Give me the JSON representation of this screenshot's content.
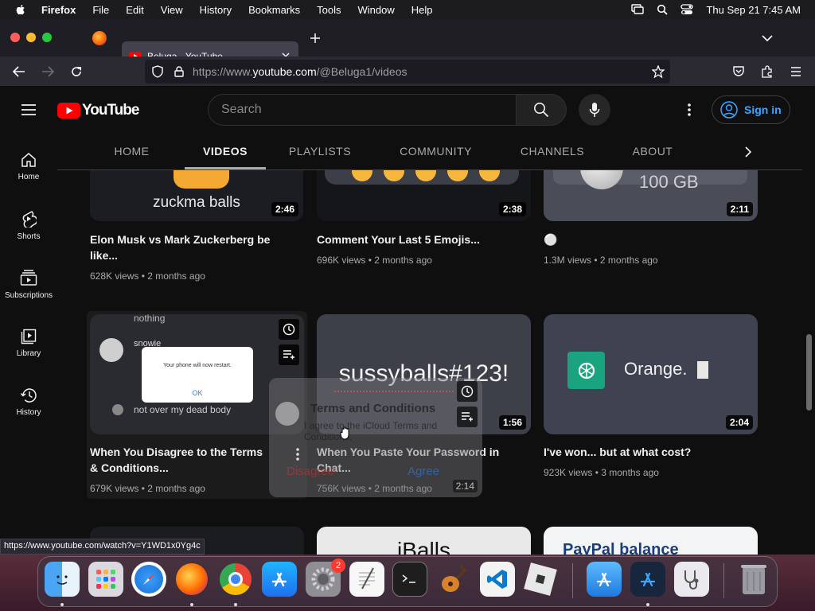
{
  "menubar": {
    "app": "Firefox",
    "items": [
      "File",
      "Edit",
      "View",
      "History",
      "Bookmarks",
      "Tools",
      "Window",
      "Help"
    ],
    "clock": "Thu Sep 21  7:45 AM"
  },
  "browser": {
    "tab_title": "Beluga - YouTube",
    "url_prefix": "https://www.",
    "url_host": "youtube.com",
    "url_path": "/@Beluga1/videos",
    "status_url": "https://www.youtube.com/watch?v=Y1WD1x0Yg4c"
  },
  "youtube": {
    "logo_text": "YouTube",
    "search_placeholder": "Search",
    "sign_in": "Sign in",
    "guide": [
      {
        "label": "Home",
        "icon": "home-icon"
      },
      {
        "label": "Shorts",
        "icon": "shorts-icon"
      },
      {
        "label": "Subscriptions",
        "icon": "subscriptions-icon"
      },
      {
        "label": "Library",
        "icon": "library-icon"
      },
      {
        "label": "History",
        "icon": "history-icon"
      }
    ],
    "channel_tabs": [
      "HOME",
      "VIDEOS",
      "PLAYLISTS",
      "COMMUNITY",
      "CHANNELS",
      "ABOUT"
    ],
    "active_tab": "VIDEOS"
  },
  "videos_row1": [
    {
      "title": "Elon Musk vs Mark Zuckerberg be like...",
      "meta": "628K views • 2 months ago",
      "duration": "2:46",
      "thumb_text": "zuckma balls"
    },
    {
      "title": "Comment Your Last 5 Emojis...",
      "meta": "696K views • 2 months ago",
      "duration": "2:38",
      "thumb_text": ""
    },
    {
      "title": "⚪",
      "meta": "1.3M views • 2 months ago",
      "duration": "2:11",
      "thumb_text": "100 GB"
    }
  ],
  "videos_row2": [
    {
      "title": "When You Disagree to the Terms & Conditions...",
      "meta": "679K views • 2 months ago",
      "duration": "",
      "thumb_user": "snowie",
      "thumb_line1": "nothing",
      "thumb_dialog": "Your phone will now restart.",
      "thumb_ok": "OK",
      "thumb_input": "not over my dead body"
    },
    {
      "title": "When You Paste Your Password in Chat...",
      "meta": "756K views • 2 months ago",
      "duration": "1:56",
      "thumb_text": "sussyballs#123!"
    },
    {
      "title": "I've won... but at what cost?",
      "meta": "923K views • 3 months ago",
      "duration": "2:04",
      "thumb_text": "Orange."
    }
  ],
  "drag_ghost": {
    "title": "Terms and Conditions",
    "body": "I agree to the iCloud Terms and Conditions.",
    "disagree": "Disagree",
    "agree": "Agree",
    "duration": "2:14"
  },
  "videos_row3": [
    {
      "thumb_text": ""
    },
    {
      "thumb_text": "iBalls"
    },
    {
      "thumb_text": "PayPal balance"
    }
  ],
  "dock": {
    "badge": "2"
  }
}
